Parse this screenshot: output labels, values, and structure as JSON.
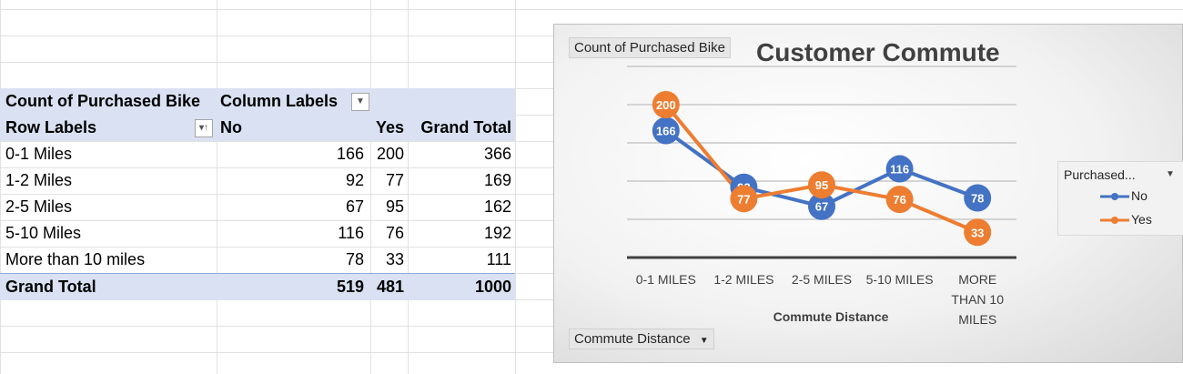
{
  "pivot": {
    "header1": {
      "value_label": "Count of Purchased Bike",
      "col_label": "Column Labels"
    },
    "header2": {
      "row_label": "Row Labels",
      "col_no": "No",
      "col_yes": "Yes",
      "col_total": "Grand Total"
    },
    "rows": [
      {
        "label": "0-1 Miles",
        "no": "166",
        "yes": "200",
        "total": "366"
      },
      {
        "label": "1-2 Miles",
        "no": "92",
        "yes": "77",
        "total": "169"
      },
      {
        "label": "2-5 Miles",
        "no": "67",
        "yes": "95",
        "total": "162"
      },
      {
        "label": "5-10 Miles",
        "no": "116",
        "yes": "76",
        "total": "192"
      },
      {
        "label": "More than 10 miles",
        "no": "78",
        "yes": "33",
        "total": "111"
      }
    ],
    "grand": {
      "label": "Grand Total",
      "no": "519",
      "yes": "481",
      "total": "1000"
    }
  },
  "chart_data": {
    "type": "line",
    "title": "Customer Commute",
    "xlabel": "Commute Distance",
    "ylabel": "",
    "categories": [
      "0-1 MILES",
      "1-2 MILES",
      "2-5 MILES",
      "5-10 MILES",
      "MORE THAN 10 MILES"
    ],
    "series": [
      {
        "name": "No",
        "values": [
          166,
          92,
          67,
          116,
          78
        ],
        "color": "#4472c4"
      },
      {
        "name": "Yes",
        "values": [
          200,
          77,
          95,
          76,
          33
        ],
        "color": "#ed7d31"
      }
    ],
    "ylim": [
      0,
      250
    ],
    "grid": true,
    "legend": {
      "title": "Purchased...",
      "placement": "right"
    },
    "value_field_button": "Count of Purchased Bike",
    "axis_field_button": "Commute Distance"
  }
}
